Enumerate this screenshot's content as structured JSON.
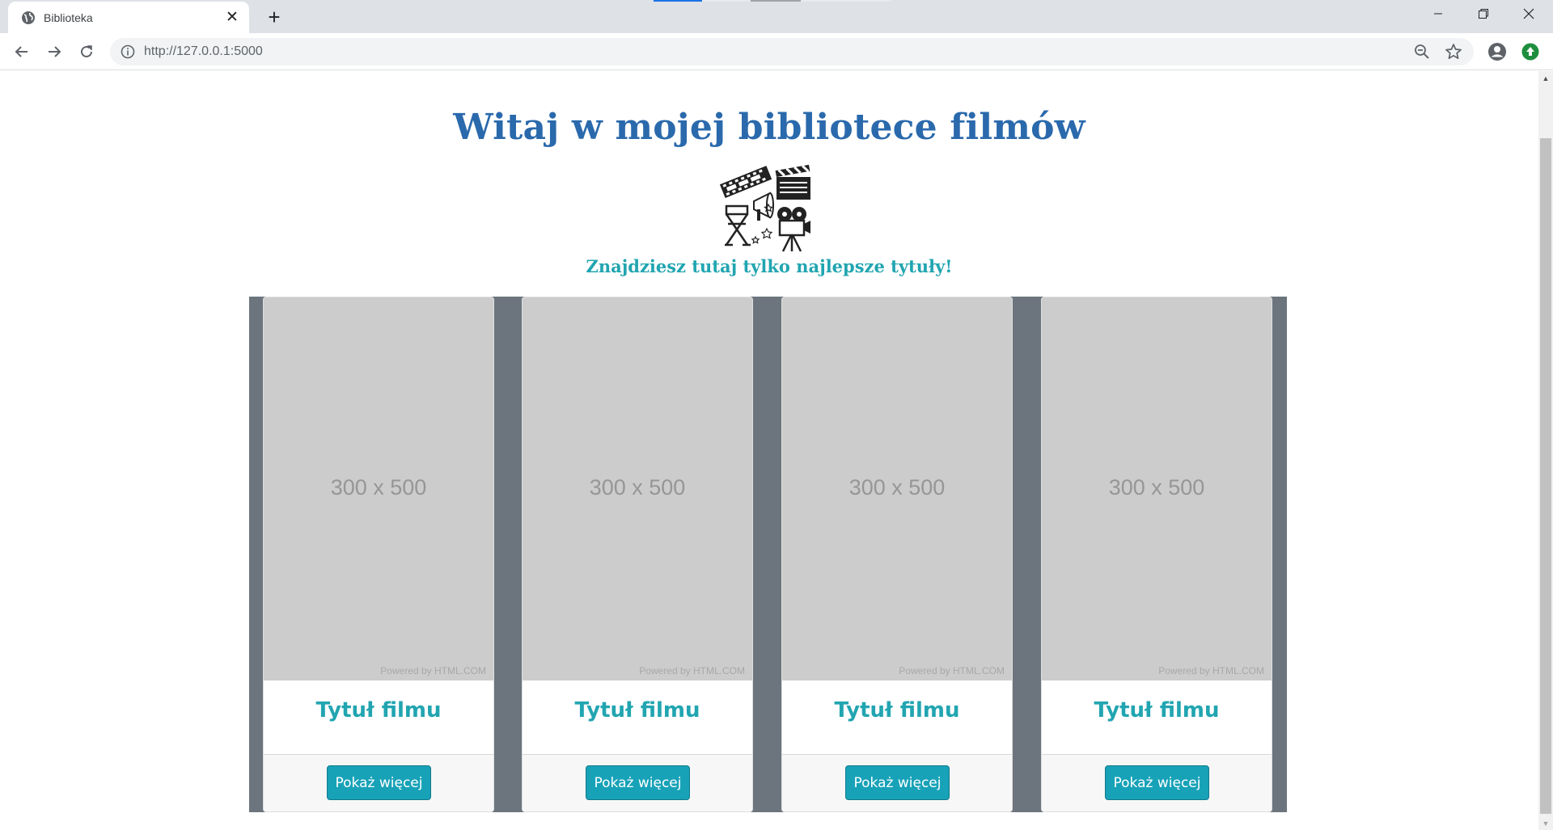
{
  "browser": {
    "tab": {
      "title": "Biblioteka",
      "favicon": "globe-icon",
      "close_glyph": "✕"
    },
    "new_tab_glyph": "+",
    "address_bar": {
      "url_host": "http://127.0.0.1",
      "url_port": ":5000",
      "info_icon": "info-icon"
    },
    "window_controls": [
      "minimize-icon",
      "restore-icon",
      "close-icon"
    ],
    "colors": {
      "tabstrip": "#dee1e6",
      "accent_tab_indicator": "#1a73e8"
    }
  },
  "page": {
    "title": "Witaj w mojej bibliotece filmów",
    "subtitle": "Znajdziesz tutaj tylko najlepsze tytuły!",
    "hero_image": "film-collage-icon",
    "colors": {
      "title": "#2a69ac",
      "accent": "#21a5b1",
      "deck_bg": "#6c757d",
      "button": "#17a2b8"
    }
  },
  "cards": [
    {
      "placeholder_size": "300 x 500",
      "placeholder_credit": "Powered by HTML.COM",
      "title": "Tytuł filmu",
      "button": "Pokaż więcej"
    },
    {
      "placeholder_size": "300 x 500",
      "placeholder_credit": "Powered by HTML.COM",
      "title": "Tytuł filmu",
      "button": "Pokaż więcej"
    },
    {
      "placeholder_size": "300 x 500",
      "placeholder_credit": "Powered by HTML.COM",
      "title": "Tytuł filmu",
      "button": "Pokaż więcej"
    },
    {
      "placeholder_size": "300 x 500",
      "placeholder_credit": "Powered by HTML.COM",
      "title": "Tytuł filmu",
      "button": "Pokaż więcej"
    }
  ]
}
